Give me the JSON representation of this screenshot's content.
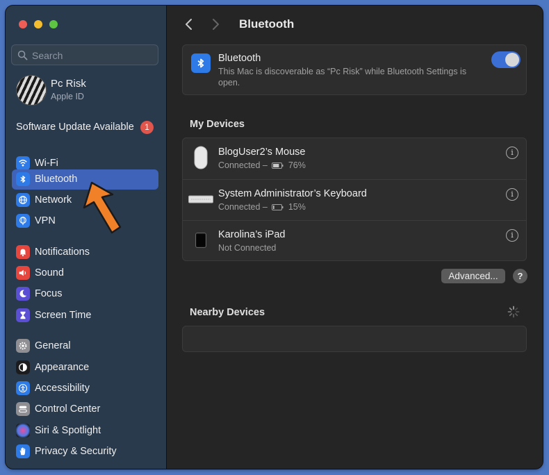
{
  "sidebar": {
    "search": {
      "placeholder": "Search"
    },
    "profile": {
      "name": "Pc Risk",
      "subtitle": "Apple ID"
    },
    "update": {
      "label": "Software Update Available",
      "count": "1"
    },
    "items": [
      {
        "label": "Wi-Fi",
        "icon": "wifi-icon",
        "color": "#2e7ae6"
      },
      {
        "label": "Bluetooth",
        "icon": "bluetooth-icon",
        "color": "#2e7ae6",
        "selected": true
      },
      {
        "label": "Network",
        "icon": "globe-icon",
        "color": "#2e7ae6"
      },
      {
        "label": "VPN",
        "icon": "vpn-globe-icon",
        "color": "#2e7ae6"
      },
      {
        "label": "Notifications",
        "icon": "bell-icon",
        "color": "#e5473f"
      },
      {
        "label": "Sound",
        "icon": "speaker-icon",
        "color": "#e5473f"
      },
      {
        "label": "Focus",
        "icon": "moon-icon",
        "color": "#5b4fd3"
      },
      {
        "label": "Screen Time",
        "icon": "hourglass-icon",
        "color": "#5b4fd3"
      },
      {
        "label": "General",
        "icon": "gear-icon",
        "color": "#8e8e93"
      },
      {
        "label": "Appearance",
        "icon": "appearance-icon",
        "color": "#1c1c1e"
      },
      {
        "label": "Accessibility",
        "icon": "accessibility-icon",
        "color": "#2e7ae6"
      },
      {
        "label": "Control Center",
        "icon": "control-center-icon",
        "color": "#8e8e93"
      },
      {
        "label": "Siri & Spotlight",
        "icon": "siri-icon",
        "color": "#7a4fd8"
      },
      {
        "label": "Privacy & Security",
        "icon": "hand-icon",
        "color": "#2e7ae6"
      }
    ]
  },
  "main": {
    "title": "Bluetooth",
    "bluetooth": {
      "title": "Bluetooth",
      "description": "This Mac is discoverable as “Pc Risk” while Bluetooth Settings is open.",
      "enabled": true
    },
    "my_devices": {
      "title": "My Devices",
      "devices": [
        {
          "name": "BlogUser2’s Mouse",
          "status": "Connected –",
          "battery": "76%",
          "battery_level": 0.76,
          "icon": "mouse-icon"
        },
        {
          "name": "System Administrator’s Keyboard",
          "status": "Connected –",
          "battery": "15%",
          "battery_level": 0.15,
          "icon": "keyboard-icon"
        },
        {
          "name": "Karolina’s iPad",
          "status": "Not Connected",
          "battery": "",
          "icon": "ipad-icon"
        }
      ]
    },
    "advanced_label": "Advanced...",
    "help_label": "?",
    "nearby": {
      "title": "Nearby Devices"
    },
    "colors": {
      "accent": "#3f63b8",
      "toggle": "#3b6fd6"
    }
  }
}
